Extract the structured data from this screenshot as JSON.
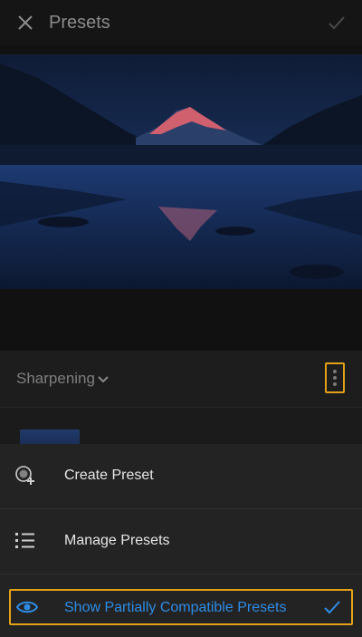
{
  "header": {
    "title": "Presets",
    "close_icon": "close-icon",
    "confirm_icon": "checkmark-icon"
  },
  "photo": {
    "description_icon": "photo-preview"
  },
  "group": {
    "label": "Sharpening",
    "chevron_icon": "chevron-down-icon",
    "more_icon": "more-vertical-icon"
  },
  "menu": {
    "items": [
      {
        "label": "Create Preset",
        "icon": "create-preset-icon"
      },
      {
        "label": "Manage Presets",
        "icon": "list-icon"
      },
      {
        "label": "Show Partially Compatible Presets",
        "icon": "eye-icon",
        "checked": true
      }
    ]
  },
  "colors": {
    "accent_highlight": "#e3a117",
    "link_blue": "#2e8ce6"
  }
}
